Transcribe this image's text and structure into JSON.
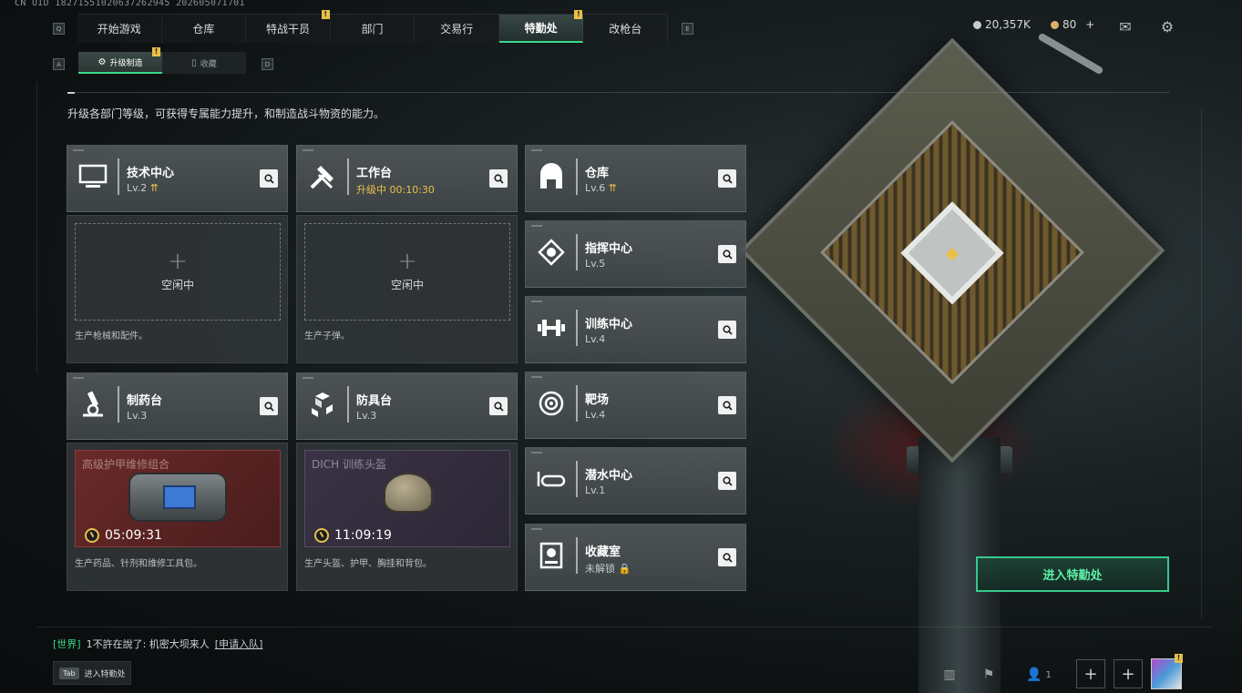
{
  "uid": "CN UID 18271551020637262945 202605071701",
  "top_tabs": [
    {
      "label": "开始游戏",
      "marked": false
    },
    {
      "label": "仓库",
      "marked": false
    },
    {
      "label": "特战干员",
      "marked": true
    },
    {
      "label": "部门",
      "marked": false
    },
    {
      "label": "交易行",
      "marked": false
    },
    {
      "label": "特勤处",
      "marked": true,
      "active": true
    },
    {
      "label": "改枪台",
      "marked": false
    }
  ],
  "keys": {
    "left": "Q",
    "right": "E",
    "sub_left": "A",
    "sub_right": "D"
  },
  "sub_tabs": [
    {
      "label": "升级制造",
      "active": true,
      "marked": true
    },
    {
      "label": "收藏",
      "active": false,
      "marked": false
    }
  ],
  "currency": {
    "balance": "20,357K",
    "coupons": "80",
    "add": "+"
  },
  "icons": {
    "mail": "mail-icon",
    "settings": "gear-icon"
  },
  "description": "升级各部门等级，可获得专属能力提升，和制造战斗物资的能力。",
  "stations": {
    "tech": {
      "title": "技术中心",
      "level": "Lv.2",
      "upgradable": true,
      "idle": "空闲中",
      "desc": "生产枪械和配件。"
    },
    "workbench": {
      "title": "工作台",
      "status": "升级中 00:10:30",
      "idle": "空闲中",
      "desc": "生产子弹。"
    },
    "pharmacy": {
      "title": "制药台",
      "level": "Lv.3",
      "craft_name": "高级护甲维修组合",
      "timer": "05:09:31",
      "desc": "生产药品、针剂和维修工具包。"
    },
    "armor": {
      "title": "防具台",
      "level": "Lv.3",
      "craft_name": "DICH 训练头盔",
      "timer": "11:09:19",
      "desc": "生产头盔、护甲、胸挂和背包。"
    }
  },
  "side_stations": [
    {
      "title": "仓库",
      "level": "Lv.6",
      "upgradable": true,
      "icon": "warehouse-icon"
    },
    {
      "title": "指挥中心",
      "level": "Lv.5",
      "upgradable": false,
      "icon": "command-icon"
    },
    {
      "title": "训练中心",
      "level": "Lv.4",
      "upgradable": false,
      "icon": "dumbbell-icon"
    },
    {
      "title": "靶场",
      "level": "Lv.4",
      "upgradable": false,
      "icon": "target-icon"
    },
    {
      "title": "潜水中心",
      "level": "Lv.1",
      "upgradable": false,
      "icon": "diving-mask-icon"
    },
    {
      "title": "收藏室",
      "level": "未解锁",
      "upgradable": false,
      "locked": true,
      "icon": "collection-icon"
    }
  ],
  "enter_button": "进入特勤处",
  "chat": {
    "channel": "[世界]",
    "message": "1不許在說了: 机密大坝来人",
    "link": "[申请入队]"
  },
  "tab_hint": {
    "key": "Tab",
    "label": "进入特勤处"
  },
  "bottom": {
    "friends_count": "1",
    "plus": "+"
  }
}
